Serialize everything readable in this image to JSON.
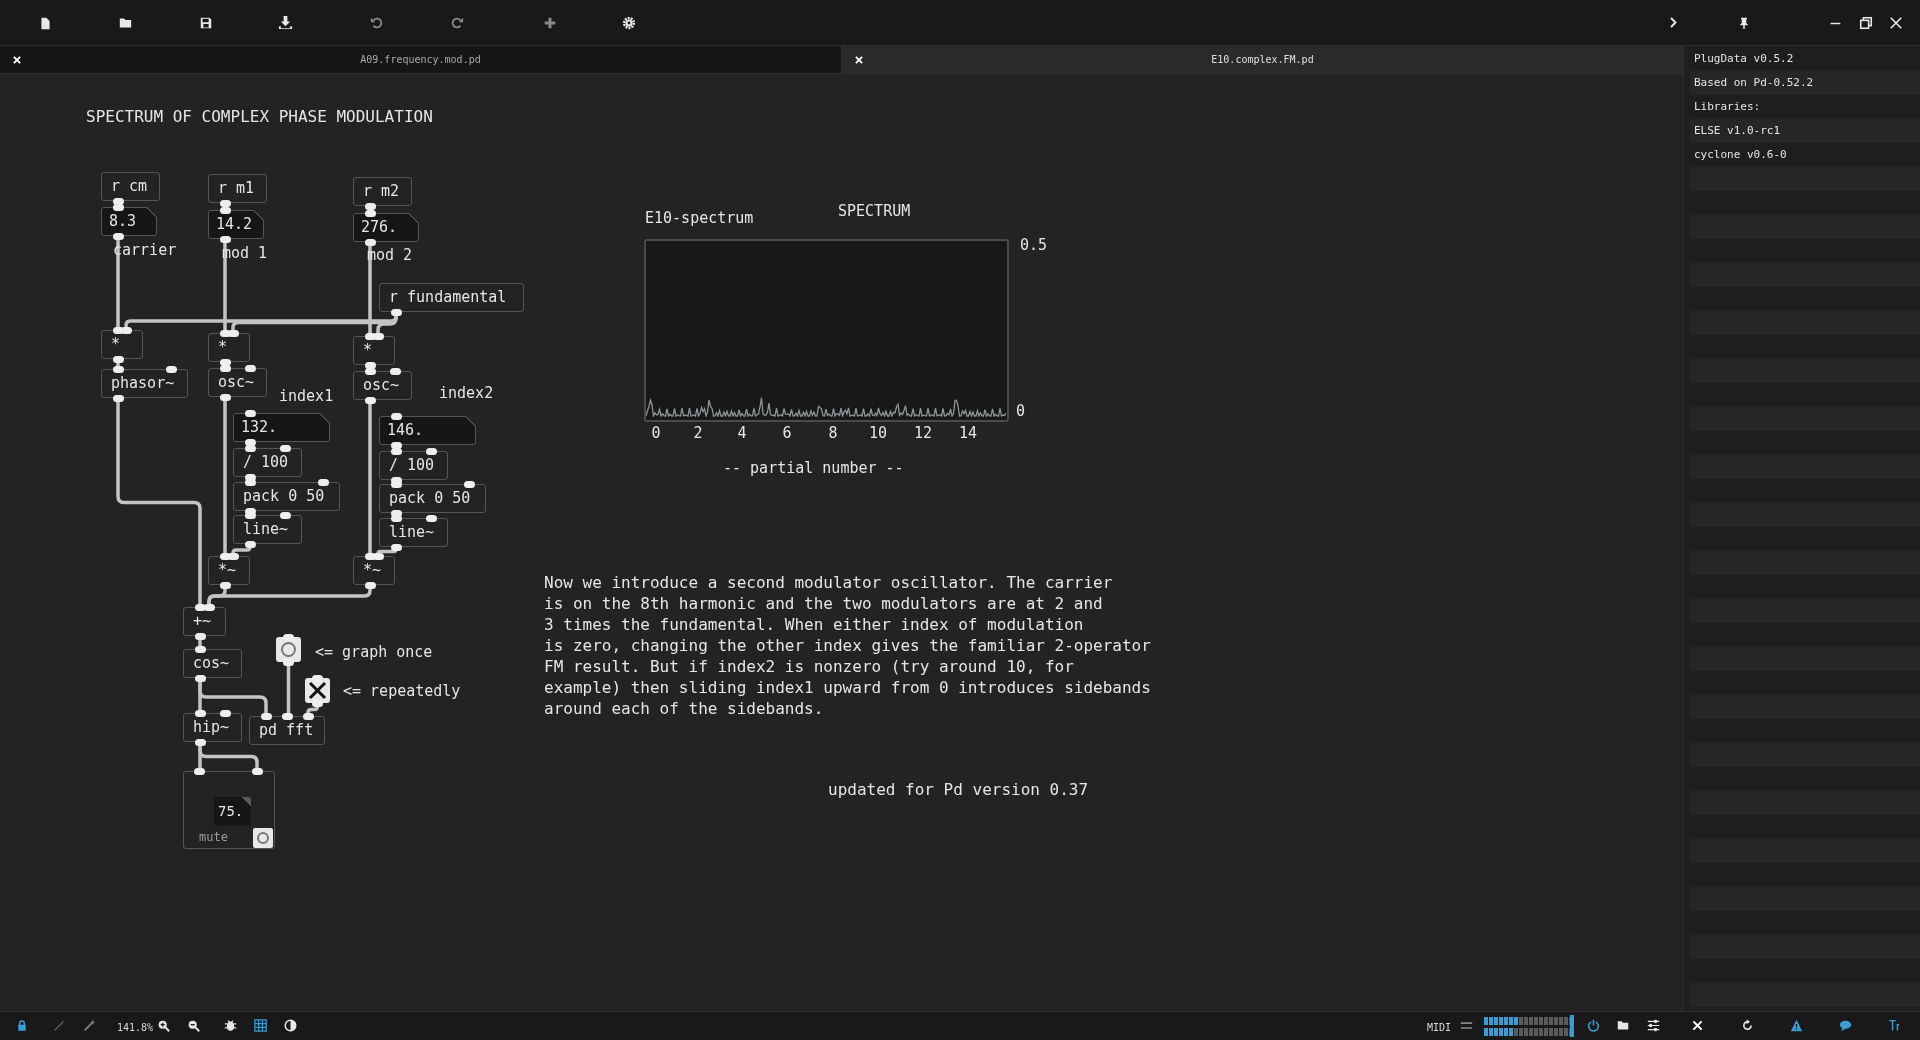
{
  "tabs": [
    {
      "label": "A09.frequency.mod.pd",
      "selected": false
    },
    {
      "label": "E10.complex.FM.pd",
      "selected": true
    }
  ],
  "patch": {
    "title": "SPECTRUM OF COMPLEX PHASE MODULATION",
    "objects": [
      {
        "kind": "object",
        "text": "r cm"
      },
      {
        "kind": "number",
        "text": "8.3"
      },
      {
        "kind": "comment",
        "text": "carrier"
      },
      {
        "kind": "object",
        "text": "r m1"
      },
      {
        "kind": "number",
        "text": "14.2"
      },
      {
        "kind": "comment",
        "text": "mod 1"
      },
      {
        "kind": "object",
        "text": "r m2"
      },
      {
        "kind": "number",
        "text": "276."
      },
      {
        "kind": "comment",
        "text": "mod 2"
      },
      {
        "kind": "object",
        "text": "r fundamental"
      },
      {
        "kind": "object",
        "text": "*"
      },
      {
        "kind": "object",
        "text": "*"
      },
      {
        "kind": "object",
        "text": "*"
      },
      {
        "kind": "object",
        "text": "phasor~"
      },
      {
        "kind": "object",
        "text": "osc~"
      },
      {
        "kind": "comment",
        "text": "index1"
      },
      {
        "kind": "object",
        "text": "osc~"
      },
      {
        "kind": "comment",
        "text": "index2"
      },
      {
        "kind": "number",
        "text": "132."
      },
      {
        "kind": "object",
        "text": "/ 100"
      },
      {
        "kind": "object",
        "text": "pack 0 50"
      },
      {
        "kind": "object",
        "text": "line~"
      },
      {
        "kind": "number",
        "text": "146."
      },
      {
        "kind": "object",
        "text": "/ 100"
      },
      {
        "kind": "object",
        "text": "pack 0 50"
      },
      {
        "kind": "object",
        "text": "line~"
      },
      {
        "kind": "object",
        "text": "*~"
      },
      {
        "kind": "object",
        "text": "*~"
      },
      {
        "kind": "object",
        "text": "+~"
      },
      {
        "kind": "bang"
      },
      {
        "kind": "comment",
        "text": "<= graph once"
      },
      {
        "kind": "object",
        "text": "cos~"
      },
      {
        "kind": "toggle",
        "checked": true
      },
      {
        "kind": "comment",
        "text": "<= repeatedly"
      },
      {
        "kind": "object",
        "text": "hip~"
      },
      {
        "kind": "object",
        "text": "pd fft"
      },
      {
        "kind": "subpatch",
        "number": "75.",
        "label": "mute"
      }
    ],
    "graph": {
      "name": "E10-spectrum",
      "title": "SPECTRUM",
      "y_max": "0.5",
      "y_min": "0",
      "x_ticks": [
        "0",
        "2",
        "4",
        "6",
        "8",
        "10",
        "12",
        "14"
      ],
      "x_label": "-- partial number --"
    },
    "description": "Now we introduce a second modulator oscillator. The carrier\nis on the 8th harmonic and the two modulators are at 2 and\n3 times the fundamental. When either index of modulation\nis zero, changing the other index gives the familiar 2-operator\nFM result. But if index2 is nonzero (try around 10, for\nexample) then sliding index1 upward from 0 introduces sidebands\naround each of the sidebands.",
    "footer": "updated for Pd version 0.37"
  },
  "sidebar": {
    "lines": [
      "PlugData v0.5.2",
      "Based on Pd-0.52.2",
      "Libraries:",
      "ELSE v1.0-rc1",
      "cyclone v0.6-0"
    ]
  },
  "status_bar": {
    "zoom": "141.8%",
    "midi": "MIDI",
    "meters": [
      {
        "level": 0.4
      },
      {
        "level": 0.34
      }
    ]
  }
}
